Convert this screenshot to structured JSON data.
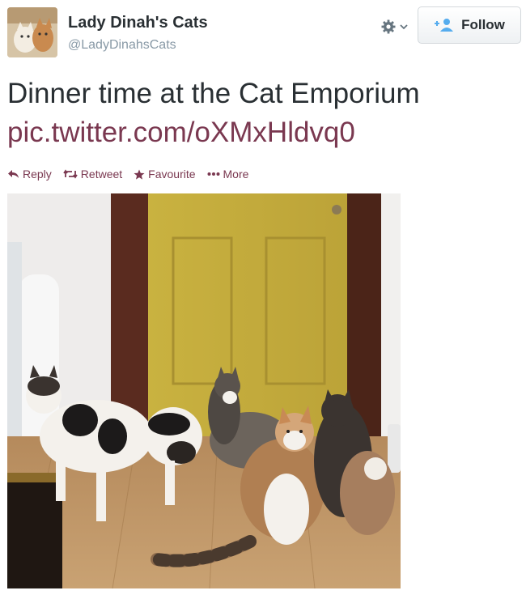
{
  "user": {
    "name": "Lady Dinah's Cats",
    "handle": "@LadyDinahsCats",
    "avatar_icon": "cat-avatar"
  },
  "header": {
    "gear_icon": "gear-icon",
    "follow_label": "Follow",
    "follow_icon": "add-person-icon"
  },
  "tweet": {
    "text": "Dinner time at the Cat Emporium",
    "link": "pic.twitter.com/oXMxHldvq0"
  },
  "actions": {
    "reply": "Reply",
    "retweet": "Retweet",
    "favourite": "Favourite",
    "more": "More"
  },
  "colors": {
    "link": "#7a3850",
    "text": "#292f33",
    "handle": "#8899a6"
  }
}
